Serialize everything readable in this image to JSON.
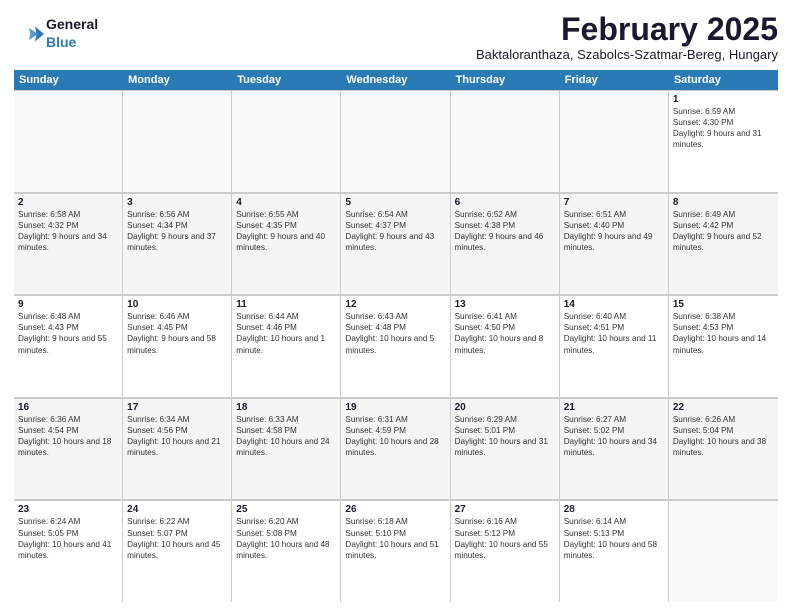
{
  "logo": {
    "general": "General",
    "blue": "Blue"
  },
  "title": "February 2025",
  "subtitle": "Baktaloranthaza, Szabolcs-Szatmar-Bereg, Hungary",
  "weekdays": [
    "Sunday",
    "Monday",
    "Tuesday",
    "Wednesday",
    "Thursday",
    "Friday",
    "Saturday"
  ],
  "rows": [
    [
      {
        "day": "",
        "info": ""
      },
      {
        "day": "",
        "info": ""
      },
      {
        "day": "",
        "info": ""
      },
      {
        "day": "",
        "info": ""
      },
      {
        "day": "",
        "info": ""
      },
      {
        "day": "",
        "info": ""
      },
      {
        "day": "1",
        "info": "Sunrise: 6:59 AM\nSunset: 4:30 PM\nDaylight: 9 hours and 31 minutes."
      }
    ],
    [
      {
        "day": "2",
        "info": "Sunrise: 6:58 AM\nSunset: 4:32 PM\nDaylight: 9 hours and 34 minutes."
      },
      {
        "day": "3",
        "info": "Sunrise: 6:56 AM\nSunset: 4:34 PM\nDaylight: 9 hours and 37 minutes."
      },
      {
        "day": "4",
        "info": "Sunrise: 6:55 AM\nSunset: 4:35 PM\nDaylight: 9 hours and 40 minutes."
      },
      {
        "day": "5",
        "info": "Sunrise: 6:54 AM\nSunset: 4:37 PM\nDaylight: 9 hours and 43 minutes."
      },
      {
        "day": "6",
        "info": "Sunrise: 6:52 AM\nSunset: 4:38 PM\nDaylight: 9 hours and 46 minutes."
      },
      {
        "day": "7",
        "info": "Sunrise: 6:51 AM\nSunset: 4:40 PM\nDaylight: 9 hours and 49 minutes."
      },
      {
        "day": "8",
        "info": "Sunrise: 6:49 AM\nSunset: 4:42 PM\nDaylight: 9 hours and 52 minutes."
      }
    ],
    [
      {
        "day": "9",
        "info": "Sunrise: 6:48 AM\nSunset: 4:43 PM\nDaylight: 9 hours and 55 minutes."
      },
      {
        "day": "10",
        "info": "Sunrise: 6:46 AM\nSunset: 4:45 PM\nDaylight: 9 hours and 58 minutes."
      },
      {
        "day": "11",
        "info": "Sunrise: 6:44 AM\nSunset: 4:46 PM\nDaylight: 10 hours and 1 minute."
      },
      {
        "day": "12",
        "info": "Sunrise: 6:43 AM\nSunset: 4:48 PM\nDaylight: 10 hours and 5 minutes."
      },
      {
        "day": "13",
        "info": "Sunrise: 6:41 AM\nSunset: 4:50 PM\nDaylight: 10 hours and 8 minutes."
      },
      {
        "day": "14",
        "info": "Sunrise: 6:40 AM\nSunset: 4:51 PM\nDaylight: 10 hours and 11 minutes."
      },
      {
        "day": "15",
        "info": "Sunrise: 6:38 AM\nSunset: 4:53 PM\nDaylight: 10 hours and 14 minutes."
      }
    ],
    [
      {
        "day": "16",
        "info": "Sunrise: 6:36 AM\nSunset: 4:54 PM\nDaylight: 10 hours and 18 minutes."
      },
      {
        "day": "17",
        "info": "Sunrise: 6:34 AM\nSunset: 4:56 PM\nDaylight: 10 hours and 21 minutes."
      },
      {
        "day": "18",
        "info": "Sunrise: 6:33 AM\nSunset: 4:58 PM\nDaylight: 10 hours and 24 minutes."
      },
      {
        "day": "19",
        "info": "Sunrise: 6:31 AM\nSunset: 4:59 PM\nDaylight: 10 hours and 28 minutes."
      },
      {
        "day": "20",
        "info": "Sunrise: 6:29 AM\nSunset: 5:01 PM\nDaylight: 10 hours and 31 minutes."
      },
      {
        "day": "21",
        "info": "Sunrise: 6:27 AM\nSunset: 5:02 PM\nDaylight: 10 hours and 34 minutes."
      },
      {
        "day": "22",
        "info": "Sunrise: 6:26 AM\nSunset: 5:04 PM\nDaylight: 10 hours and 38 minutes."
      }
    ],
    [
      {
        "day": "23",
        "info": "Sunrise: 6:24 AM\nSunset: 5:05 PM\nDaylight: 10 hours and 41 minutes."
      },
      {
        "day": "24",
        "info": "Sunrise: 6:22 AM\nSunset: 5:07 PM\nDaylight: 10 hours and 45 minutes."
      },
      {
        "day": "25",
        "info": "Sunrise: 6:20 AM\nSunset: 5:08 PM\nDaylight: 10 hours and 48 minutes."
      },
      {
        "day": "26",
        "info": "Sunrise: 6:18 AM\nSunset: 5:10 PM\nDaylight: 10 hours and 51 minutes."
      },
      {
        "day": "27",
        "info": "Sunrise: 6:16 AM\nSunset: 5:12 PM\nDaylight: 10 hours and 55 minutes."
      },
      {
        "day": "28",
        "info": "Sunrise: 6:14 AM\nSunset: 5:13 PM\nDaylight: 10 hours and 58 minutes."
      },
      {
        "day": "",
        "info": ""
      }
    ]
  ]
}
